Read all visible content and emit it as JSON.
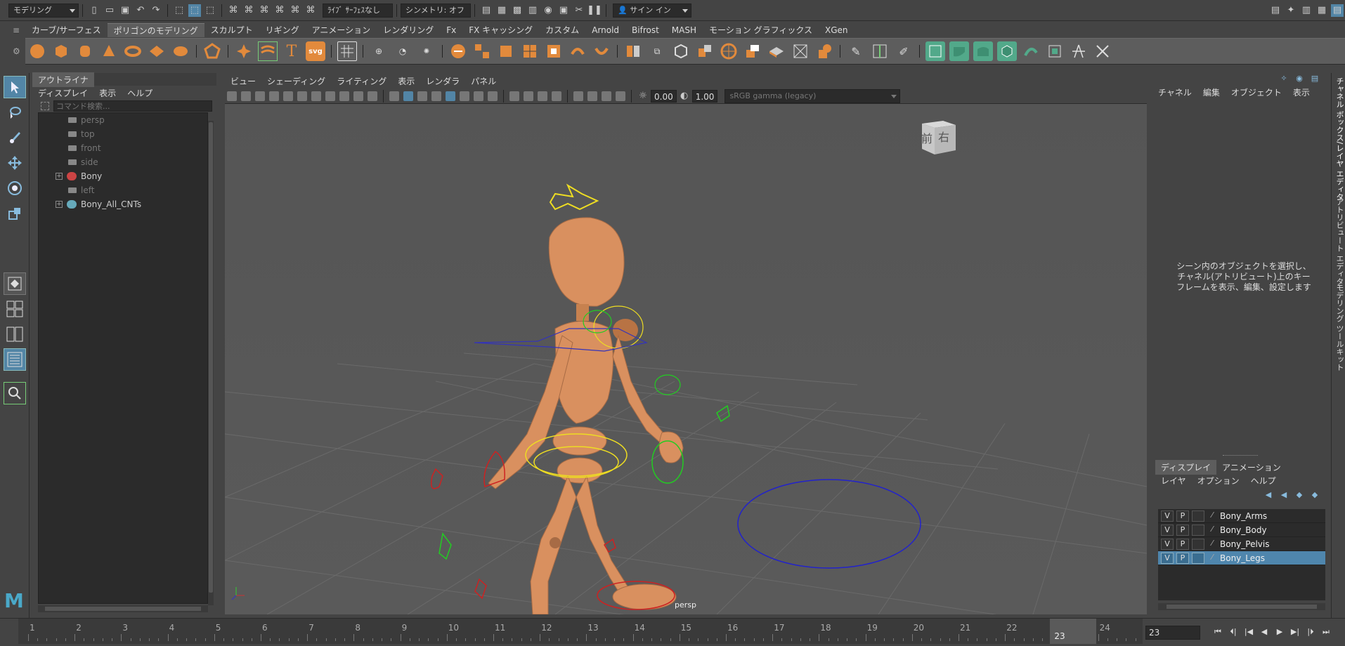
{
  "statusline": {
    "mode": "モデリング",
    "live": "ﾗｲﾌﾞ ｻｰﾌｪｽなし",
    "symmetry": "シンメトリ: オフ",
    "signin": "サイン イン"
  },
  "shelf_tabs": [
    "カーブ/サーフェス",
    "ポリゴンのモデリング",
    "スカルプト",
    "リギング",
    "アニメーション",
    "レンダリング",
    "Fx",
    "FX キャッシング",
    "カスタム",
    "Arnold",
    "Bifrost",
    "MASH",
    "モーション グラフィックス",
    "XGen"
  ],
  "shelf_active": 1,
  "shelf_icon_labels": {
    "text": "T",
    "svg": "svg"
  },
  "outliner": {
    "tab": "アウトライナ",
    "menu": [
      "ディスプレイ",
      "表示",
      "ヘルプ"
    ],
    "search_placeholder": "コマンド検索...",
    "items": [
      {
        "label": "persp",
        "dim": true
      },
      {
        "label": "top",
        "dim": true
      },
      {
        "label": "front",
        "dim": true
      },
      {
        "label": "side",
        "dim": true
      },
      {
        "label": "Bony",
        "dim": false
      },
      {
        "label": "left",
        "dim": true
      },
      {
        "label": "Bony_All_CNTs",
        "dim": false
      }
    ]
  },
  "viewport": {
    "menu": [
      "ビュー",
      "シェーディング",
      "ライティング",
      "表示",
      "レンダラ",
      "パネル"
    ],
    "exposure": "0.00",
    "gamma": "1.00",
    "colorspace": "sRGB gamma (legacy)",
    "camera": "persp",
    "viewcube": [
      "前",
      "右"
    ]
  },
  "channel": {
    "menu": [
      "チャネル",
      "編集",
      "オブジェクト",
      "表示"
    ],
    "message": "シーン内のオブジェクトを選択し、チャネル(アトリビュート)上のキーフレームを表示、編集、設定します"
  },
  "sidebar_tabs": [
    "チャネル ボックス/レイヤ エディタ",
    "アトリビュート エディタ",
    "モデリング ツールキット"
  ],
  "layers": {
    "tabs": [
      "ディスプレイ",
      "アニメーション"
    ],
    "menu": [
      "レイヤ",
      "オプション",
      "ヘルプ"
    ],
    "items": [
      {
        "v": "V",
        "p": "P",
        "name": "Bony_Arms",
        "selected": false
      },
      {
        "v": "V",
        "p": "P",
        "name": "Bony_Body",
        "selected": false
      },
      {
        "v": "V",
        "p": "P",
        "name": "Bony_Pelvis",
        "selected": false
      },
      {
        "v": "V",
        "p": "P",
        "name": "Bony_Legs",
        "selected": true
      }
    ]
  },
  "timeline": {
    "frames": [
      "1",
      "2",
      "3",
      "4",
      "5",
      "6",
      "7",
      "8",
      "9",
      "10",
      "11",
      "12",
      "13",
      "14",
      "15",
      "16",
      "17",
      "18",
      "19",
      "20",
      "21",
      "22",
      "23",
      "24"
    ],
    "current_frame": "23",
    "current_marker": "23"
  },
  "logo": "M"
}
